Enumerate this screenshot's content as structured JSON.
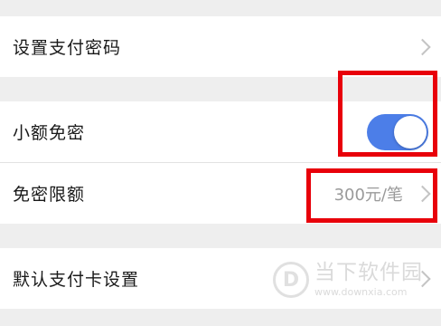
{
  "rows": [
    {
      "label": "设置支付密码"
    },
    {
      "label": "小额免密",
      "toggle_on": true
    },
    {
      "label": "免密限额",
      "value": "300元/笔"
    },
    {
      "label": "默认支付卡设置"
    }
  ],
  "colors": {
    "toggle_on": "#4c7ee8",
    "highlight_box": "#e8000a"
  },
  "watermark": {
    "title": "当下软件园",
    "url": "www.downxia.com",
    "logo_glyph": "D"
  }
}
